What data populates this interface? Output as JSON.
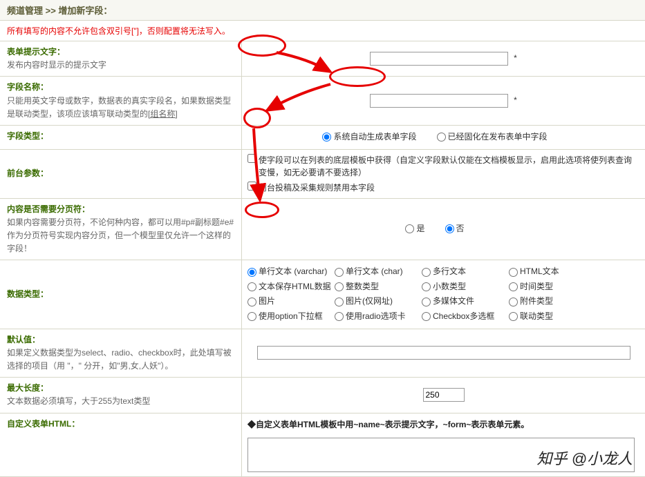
{
  "breadcrumb": "频道管理 >> 增加新字段：",
  "warning": "所有填写的内容不允许包含双引号[\"]，否则配置将无法写入。",
  "rows": {
    "prompt": {
      "title": "表单提示文字：",
      "desc": "发布内容时显示的提示文字",
      "star": "*"
    },
    "fieldname": {
      "title": "字段名称：",
      "desc_a": "只能用英文字母或数字，数据表的真实字段名，如果数据类型是联动类型，该项应该填写联动类型的",
      "desc_b": "[组名称]",
      "star": "*"
    },
    "fieldtype": {
      "title": "字段类型：",
      "opt1": "系统自动生成表单字段",
      "opt2": "已经固化在发布表单中字段"
    },
    "frontparam": {
      "title": "前台参数：",
      "cb1": "使字段可以在列表的底层模板中获得（自定义字段默认仅能在文档模板显示，启用此选项将使列表查询变慢，如无必要请不要选择）",
      "cb2": "前台投稿及采集规则禁用本字段"
    },
    "page": {
      "title": "内容是否需要分页符：",
      "desc": "如果内容需要分页符，不论何种内容，都可以用#p#副标题#e#作为分页符号实现内容分页，但一个模型里仅允许一个这样的字段！",
      "opt1": "是",
      "opt2": "否"
    },
    "datatype": {
      "title": "数据类型：",
      "opts": [
        "单行文本 (varchar)",
        "单行文本 (char)",
        "多行文本",
        "HTML文本",
        "文本保存HTML数据",
        "整数类型",
        "小数类型",
        "时间类型",
        "图片",
        "图片(仅网址)",
        "多媒体文件",
        "附件类型",
        "使用option下拉框",
        "使用radio选项卡",
        "Checkbox多选框",
        "联动类型"
      ]
    },
    "default": {
      "title": "默认值：",
      "desc": "如果定义数据类型为select、radio、checkbox时，此处填写被选择的项目（用 \"，\" 分开，如\"男,女,人妖\"）。"
    },
    "maxlen": {
      "title": "最大长度：",
      "desc": "文本数据必须填写，大于255为text类型",
      "value": "250"
    },
    "customhtml": {
      "title": "自定义表单HTML：",
      "hint": "◆自定义表单HTML模板中用~name~表示提示文字，~form~表示表单元素。"
    }
  },
  "watermark": "知乎 @小龙人"
}
